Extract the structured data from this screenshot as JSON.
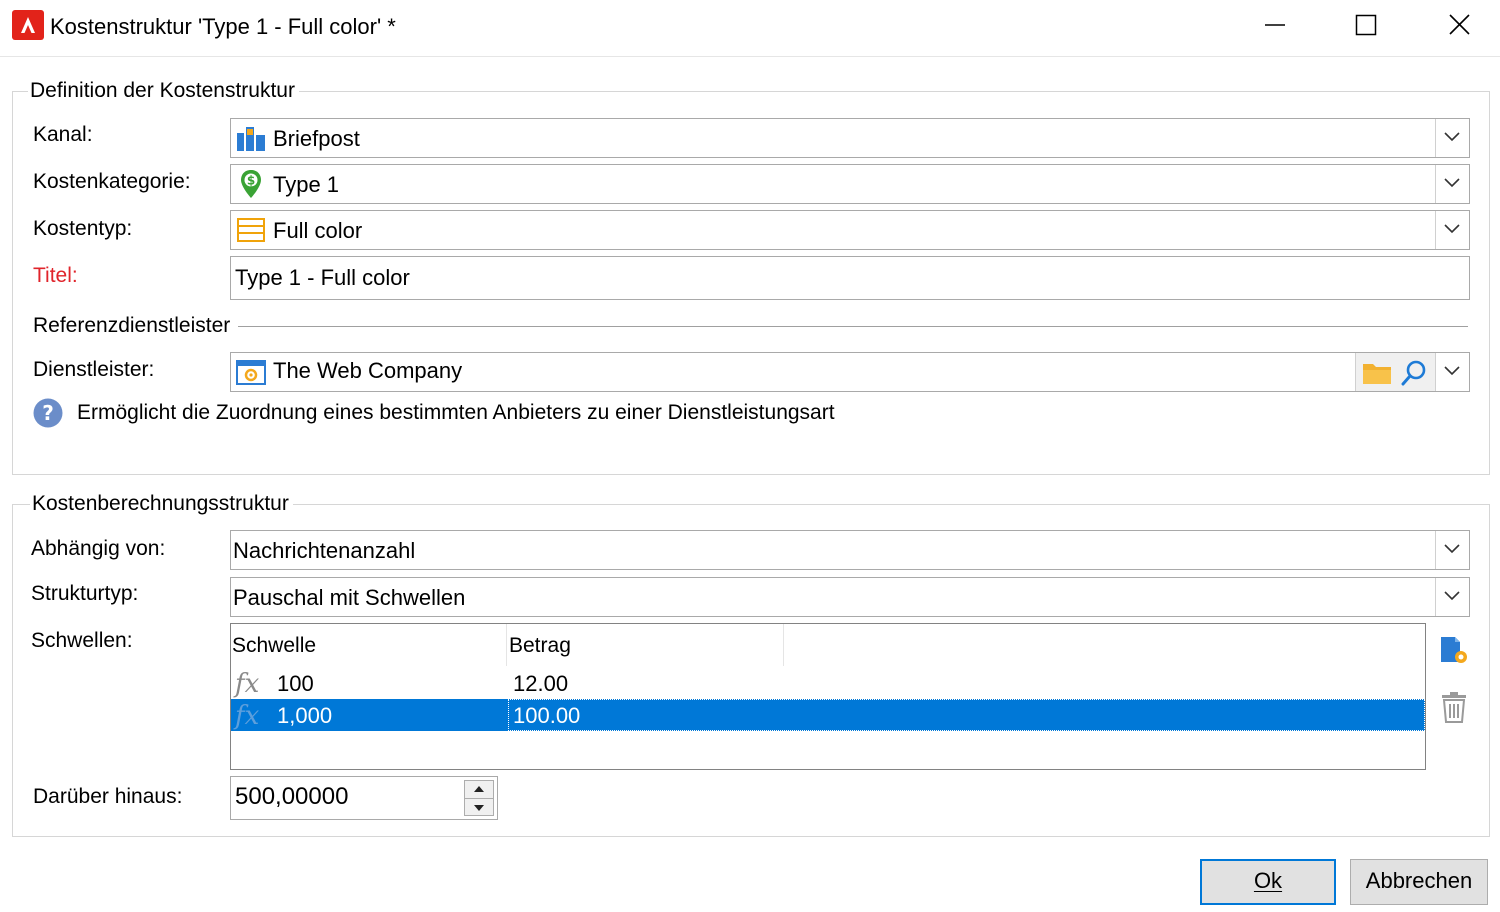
{
  "window": {
    "title": "Kostenstruktur 'Type 1 - Full color' *",
    "controls": [
      "minimize-icon",
      "maximize-icon",
      "close-icon"
    ]
  },
  "definition": {
    "group_title": "Definition der Kostenstruktur",
    "channel_label": "Kanal:",
    "channel_value": "Briefpost",
    "category_label": "Kostenkategorie:",
    "category_value": "Type 1",
    "cost_type_label": "Kostentyp:",
    "cost_type_value": "Full color",
    "title_label": "Titel:",
    "title_value": "Type 1 - Full color",
    "reference_subheading": "Referenzdienstleister",
    "provider_label": "Dienstleister:",
    "provider_value": "The Web Company",
    "help_text": "Ermöglicht die Zuordnung eines bestimmten Anbieters zu einer Dienstleistungsart"
  },
  "calculation": {
    "group_title": "Kostenberechnungsstruktur",
    "depends_label": "Abhängig von:",
    "depends_value": "Nachrichtenanzahl",
    "structure_label": "Strukturtyp:",
    "structure_value": "Pauschal mit Schwellen",
    "thresholds_label": "Schwellen:",
    "thresholds": {
      "columns": [
        "Schwelle",
        "Betrag"
      ],
      "rows": [
        {
          "threshold": "100",
          "amount": "12.00",
          "selected": false
        },
        {
          "threshold": "1,000",
          "amount": "100.00",
          "selected": true
        }
      ]
    },
    "beyond_label": "Darüber hinaus:",
    "beyond_value": "500,00000"
  },
  "buttons": {
    "ok": "Ok",
    "cancel": "Abbrechen"
  },
  "colors": {
    "accent": "#0078d7",
    "required_label": "#e0242b",
    "app_icon": "#e2231a"
  }
}
